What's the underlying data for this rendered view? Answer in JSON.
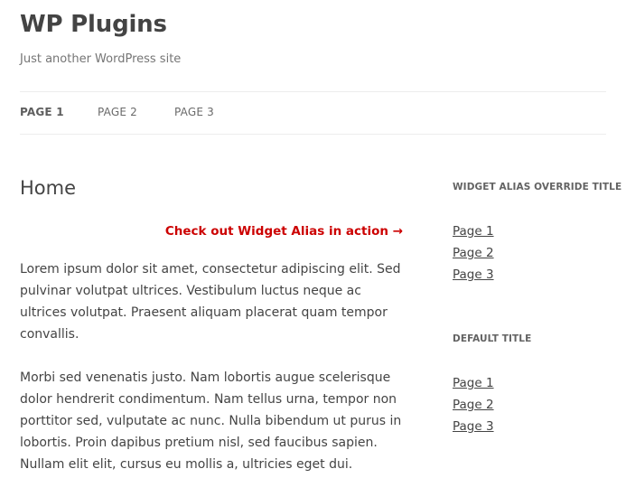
{
  "site": {
    "title": "WP Plugins",
    "description": "Just another WordPress site"
  },
  "nav": {
    "items": [
      {
        "label": "Page 1",
        "current": true
      },
      {
        "label": "Page 2",
        "current": false
      },
      {
        "label": "Page 3",
        "current": false
      }
    ]
  },
  "content": {
    "title": "Home",
    "callout": "Check out Widget Alias in action →",
    "paragraphs": [
      "Lorem ipsum dolor sit amet, consectetur adipiscing elit. Sed pulvinar volutpat ultrices. Vestibulum luctus neque ac ultrices volutpat. Praesent aliquam placerat quam tempor convallis.",
      "Morbi sed venenatis justo. Nam lobortis augue scelerisque dolor hendrerit condimentum. Nam tellus urna, tempor non porttitor sed, vulputate ac nunc. Nulla bibendum ut purus in lobortis. Proin dapibus pretium nisl, sed faucibus sapien. Nullam elit elit, cursus eu mollis a, ultricies eget dui."
    ]
  },
  "sidebar": {
    "widgets": [
      {
        "title": "Widget Alias Override Title",
        "links": [
          "Page 1",
          "Page 2",
          "Page 3"
        ]
      },
      {
        "title": "Default Title",
        "links": [
          "Page 1",
          "Page 2",
          "Page 3"
        ]
      }
    ]
  },
  "colors": {
    "callout": "#cc0000",
    "text": "#444444",
    "divider": "#ededed"
  }
}
